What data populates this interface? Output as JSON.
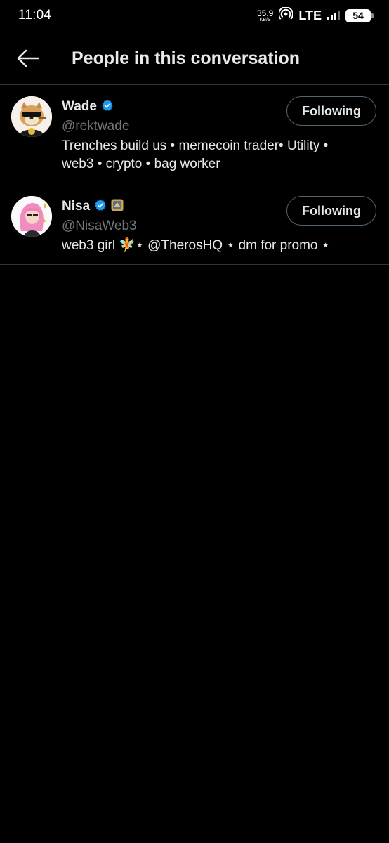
{
  "status_bar": {
    "time": "11:04",
    "net_speed_value": "35.9",
    "net_speed_unit": "KB/S",
    "network": "LTE",
    "battery": "54"
  },
  "header": {
    "title": "People in this conversation"
  },
  "people": [
    {
      "name": "Wade",
      "handle": "@rektwade",
      "bio": "Trenches build us • memecoin trader• Utility • web3 • crypto • bag worker",
      "follow_label": "Following",
      "verified": true
    },
    {
      "name": "Nisa",
      "handle": "@NisaWeb3",
      "bio": "web3 girl 🧚⋆ @TherosHQ ⋆ dm for promo ⋆",
      "follow_label": "Following",
      "verified": true
    }
  ],
  "colors": {
    "background": "#000000",
    "text_primary": "#e7e9ea",
    "text_secondary": "#71767b",
    "verified_blue": "#1d9bf0",
    "divider": "#2f3336"
  }
}
